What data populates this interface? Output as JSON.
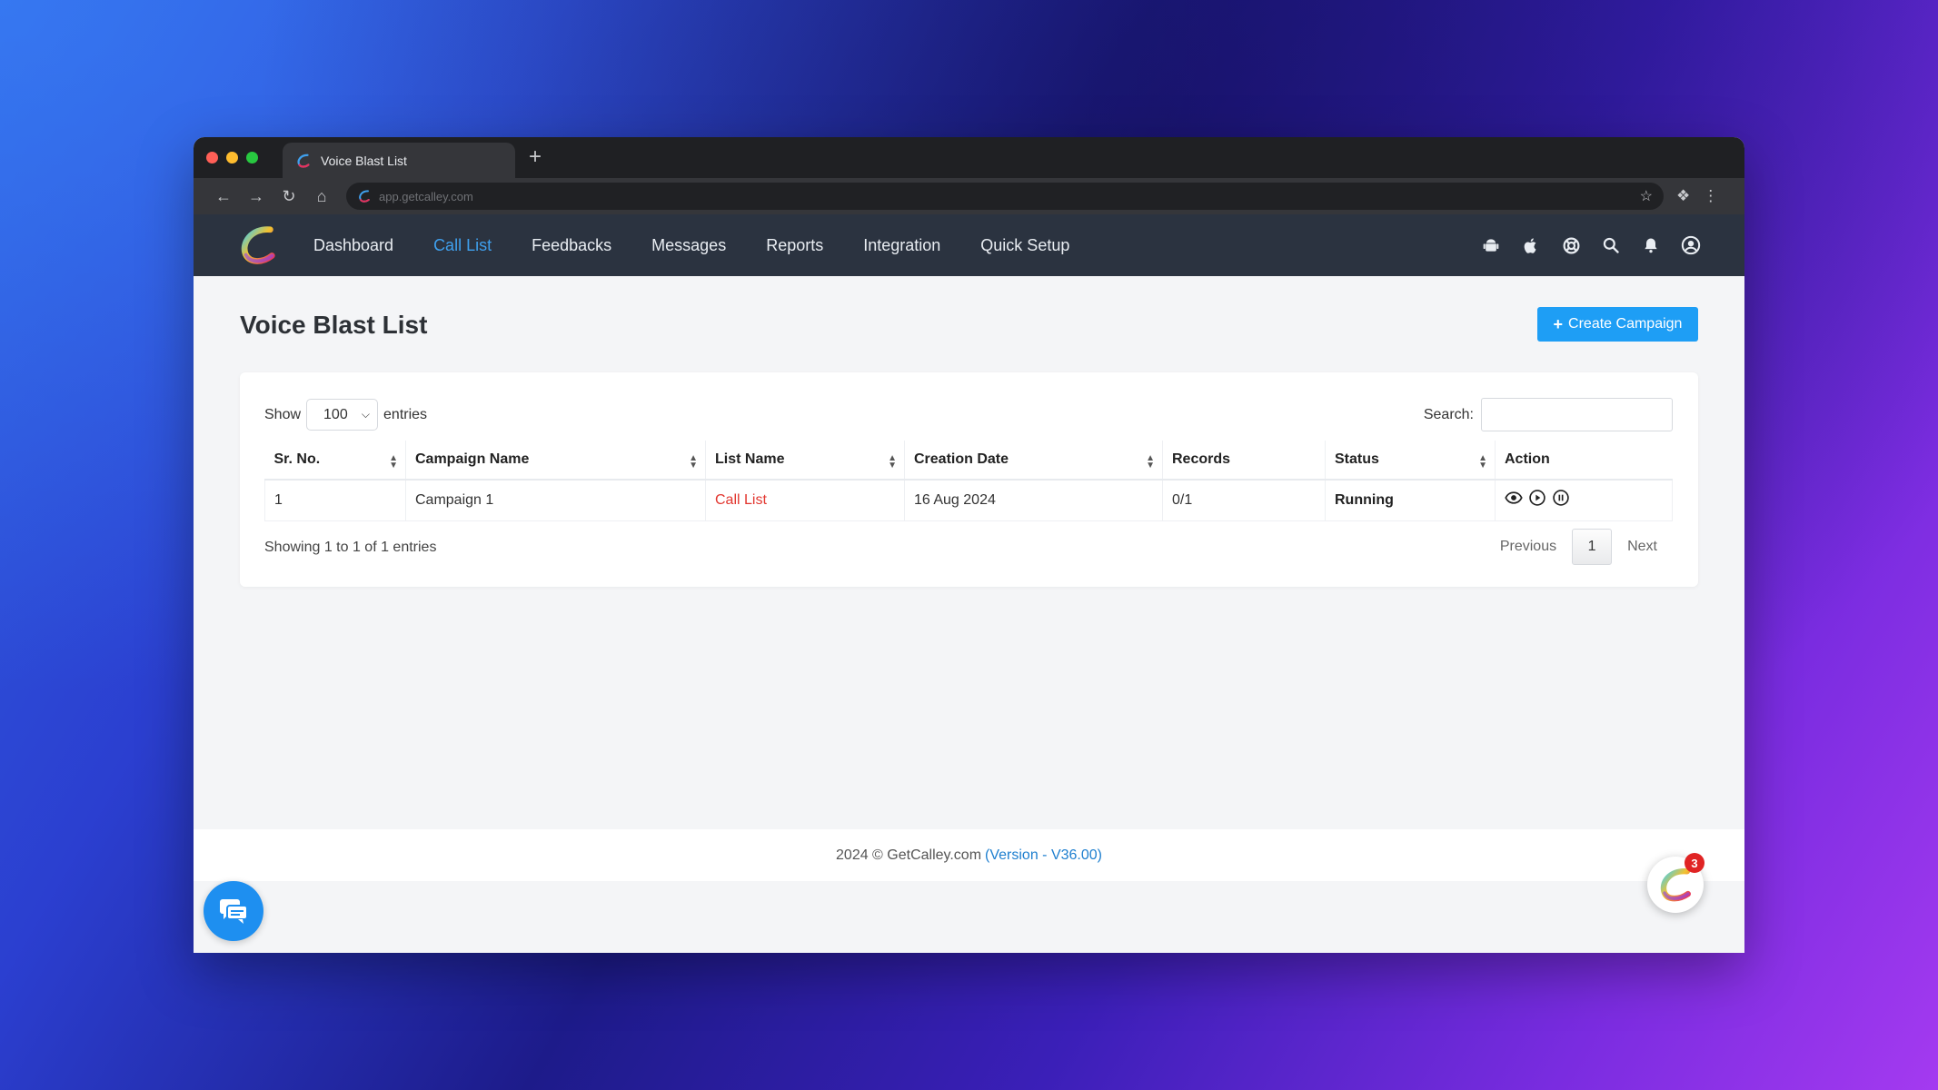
{
  "browser": {
    "tab_title": "Voice Blast List",
    "new_tab": "+",
    "url": "app.getcalley.com"
  },
  "nav": {
    "items": [
      {
        "label": "Dashboard"
      },
      {
        "label": "Call List",
        "active": true
      },
      {
        "label": "Feedbacks"
      },
      {
        "label": "Messages"
      },
      {
        "label": "Reports"
      },
      {
        "label": "Integration"
      },
      {
        "label": "Quick Setup"
      }
    ],
    "right_icons": [
      "android-icon",
      "apple-icon",
      "support-icon",
      "search-icon",
      "bell-icon",
      "user-icon"
    ]
  },
  "page": {
    "title": "Voice Blast List",
    "create_button": "Create Campaign",
    "create_icon": "+"
  },
  "table_controls": {
    "show_label": "Show",
    "entries_value": "100",
    "entries_label": "entries",
    "search_label": "Search:",
    "search_value": ""
  },
  "table": {
    "headers": [
      "Sr. No.",
      "Campaign Name",
      "List Name",
      "Creation Date",
      "Records",
      "Status",
      "Action"
    ],
    "rows": [
      {
        "sr_no": "1",
        "campaign_name": "Campaign 1",
        "list_name": "Call List",
        "creation_date": "16 Aug 2024",
        "records": "0/1",
        "status": "Running",
        "actions": [
          "eye-icon",
          "play-icon",
          "pause-icon"
        ]
      }
    ]
  },
  "pagination": {
    "info": "Showing 1 to 1 of 1 entries",
    "previous": "Previous",
    "current": "1",
    "next": "Next"
  },
  "footer": {
    "text": "2024 © GetCalley.com",
    "version": "(Version - V36.00)"
  },
  "widget": {
    "badge": "3"
  },
  "colors": {
    "nav_bg": "#2b3340",
    "accent": "#1e9ef5",
    "active_nav": "#3fa0ee",
    "link_red": "#e2362f"
  }
}
